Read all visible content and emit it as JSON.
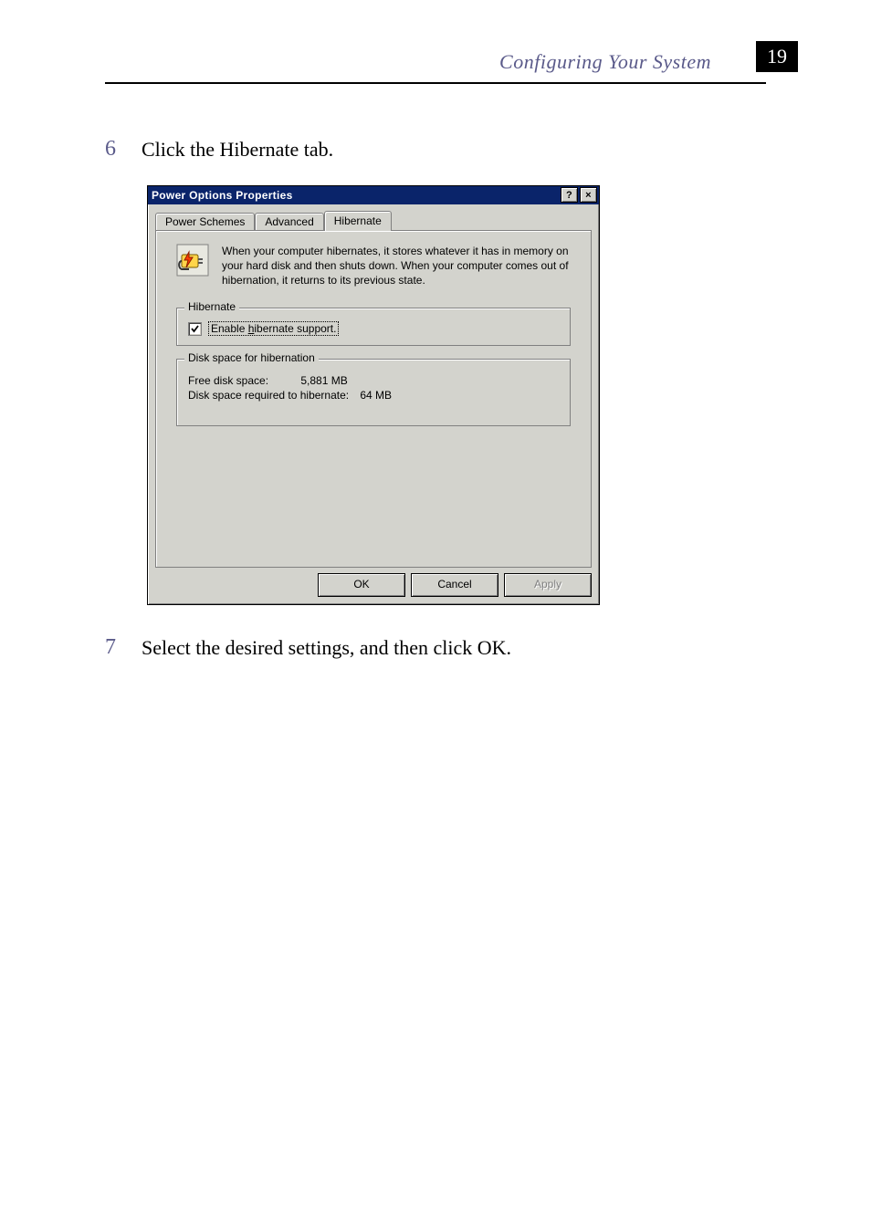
{
  "header": {
    "title": "Configuring Your System",
    "page_number": "19"
  },
  "steps": {
    "six": {
      "num": "6",
      "text": "Click the Hibernate tab."
    },
    "seven": {
      "num": "7",
      "text": "Select the desired settings, and then click OK."
    }
  },
  "dialog": {
    "title": "Power Options Properties",
    "help_glyph": "?",
    "close_glyph": "×",
    "tabs": {
      "power_schemes": "Power Schemes",
      "advanced": "Advanced",
      "hibernate": "Hibernate"
    },
    "info_text": "When your computer hibernates, it stores whatever it has in memory on your hard disk and then shuts down. When your computer comes out of hibernation, it returns to its previous state.",
    "hibernate_group": {
      "legend": "Hibernate",
      "checkbox_prefix": "Enable ",
      "checkbox_underlined": "h",
      "checkbox_suffix": "ibernate support."
    },
    "disk_group": {
      "legend": "Disk space for hibernation",
      "free_label": "Free disk space:",
      "free_value": "5,881 MB",
      "required_label": "Disk space required to hibernate:",
      "required_value": "64 MB"
    },
    "buttons": {
      "ok": "OK",
      "cancel": "Cancel",
      "apply": "Apply"
    }
  }
}
